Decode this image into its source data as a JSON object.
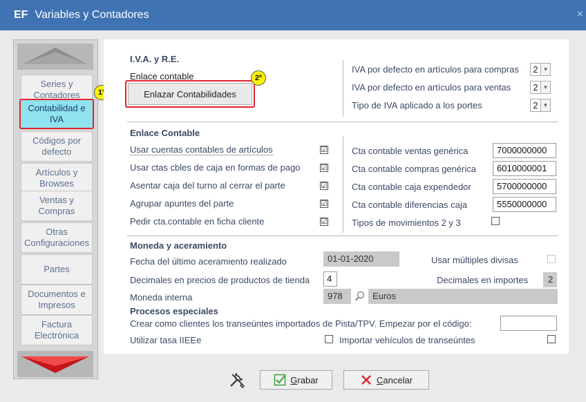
{
  "window": {
    "logo": "EF",
    "title": "Variables y Contadores",
    "close": "×"
  },
  "sidebar": {
    "items": [
      {
        "label": "Series y Contadores"
      },
      {
        "label": "Contabilidad e IVA"
      },
      {
        "label": "Códigos por defecto"
      },
      {
        "label": "Artículos y Browses"
      },
      {
        "label": "Ventas y Compras"
      },
      {
        "label": "Otras Configuraciones"
      },
      {
        "label": "Partes"
      },
      {
        "label": "Documentos e Impresos"
      },
      {
        "label": "Factura Electrónica"
      }
    ]
  },
  "annotations": {
    "step1": "1º",
    "step2": "2º"
  },
  "iva": {
    "title": "I.V.A. y R.E.",
    "enlace_label": "Enlace contable",
    "enlazar_button": "Enlazar Contabilidades",
    "compras_label": "IVA por defecto en artículos para compras",
    "compras_value": "2",
    "ventas_label": "IVA por defecto en artículos para ventas",
    "ventas_value": "2",
    "portes_label": "Tipo de IVA aplicado a los portes",
    "portes_value": "2"
  },
  "enlace": {
    "title": "Enlace Contable",
    "options": [
      {
        "label": "Usar cuentas contables de artículos",
        "checked": "☑"
      },
      {
        "label": "Usar ctas cbles de caja en formas de pago",
        "checked": "☑"
      },
      {
        "label": "Asentar caja del turno al cerrar el parte",
        "checked": "☑"
      },
      {
        "label": "Agrupar apuntes del parte",
        "checked": "☑"
      },
      {
        "label": "Pedir cta.contable en ficha cliente",
        "checked": "☑"
      }
    ],
    "accounts": [
      {
        "label": "Cta contable ventas genérica",
        "value": "7000000000"
      },
      {
        "label": "Cta contable compras genérica",
        "value": "6010000001"
      },
      {
        "label": "Cta contable caja expendedor",
        "value": "5700000000"
      },
      {
        "label": "Cta contable diferencias caja",
        "value": "5550000000"
      }
    ],
    "tipos_label": "Tipos de movimientos 2 y 3"
  },
  "moneda": {
    "title": "Moneda y aceramiento",
    "fecha_label": "Fecha del último aceramiento realizado",
    "fecha_value": "01-01-2020",
    "divisas_label": "Usar múltiples divisas",
    "decimales_precios_label": "Decimales en precios de productos de tienda",
    "decimales_precios_value": "4",
    "decimales_importes_label": "Decimales en importes",
    "decimales_importes_value": "2",
    "moneda_label": "Moneda interna",
    "moneda_code": "978",
    "moneda_name": "Euros"
  },
  "procesos": {
    "title": "Procesos especiales",
    "crear_label": "Crear como clientes los transeúntes importados de Pista/TPV. Empezar por el código:",
    "crear_value": "",
    "tasa_label": "Utilizar tasa IIEEe",
    "importar_label": "Importar vehículos de transeúntes"
  },
  "footer": {
    "grabar_key": "G",
    "grabar_rest": "rabar",
    "cancelar_key": "C",
    "cancelar_rest": "ancelar"
  },
  "colors": {
    "titlebar": "#3f73b4",
    "active_item": "#8fe3ee",
    "highlight": "#e0242b",
    "badge": "#fff200"
  }
}
